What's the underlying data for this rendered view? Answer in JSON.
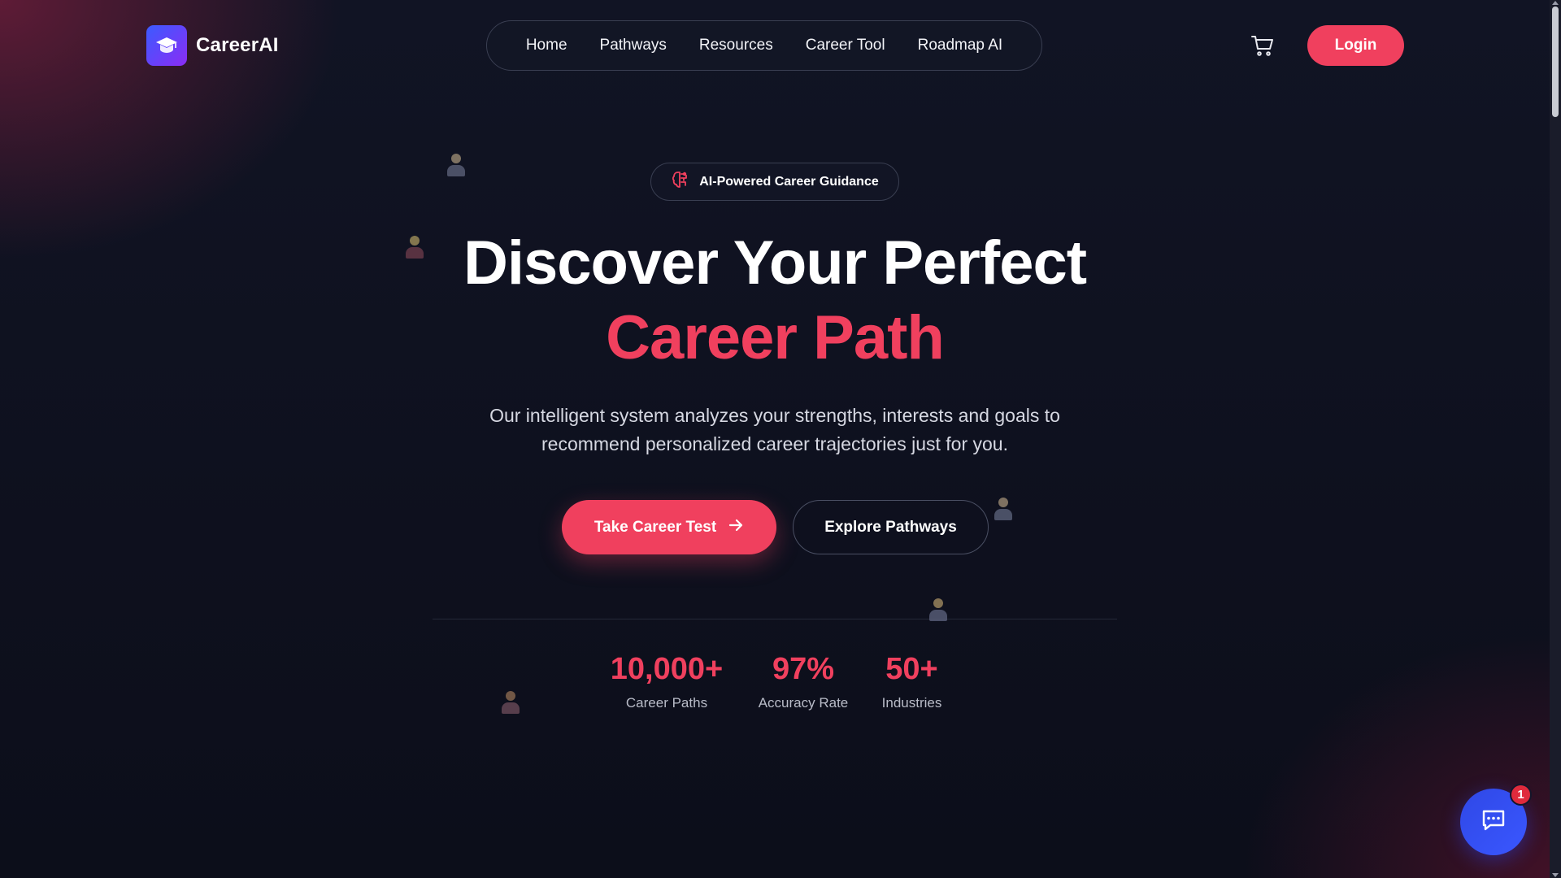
{
  "brand": {
    "name": "CareerAI",
    "logo_icon": "graduation-cap-icon",
    "gradient": [
      "#3b5bff",
      "#8b2cf5"
    ]
  },
  "nav": {
    "items": [
      {
        "label": "Home"
      },
      {
        "label": "Pathways"
      },
      {
        "label": "Resources"
      },
      {
        "label": "Career Tool"
      },
      {
        "label": "Roadmap AI"
      }
    ]
  },
  "header": {
    "cart_icon": "cart-icon",
    "login_label": "Login"
  },
  "hero": {
    "badge_icon": "brain-icon",
    "badge_label": "AI-Powered Career Guidance",
    "title_line1": "Discover Your Perfect",
    "title_line2": "Career Path",
    "subtitle_line1": "Our intelligent system analyzes your strengths, interests and goals to",
    "subtitle_line2": "recommend personalized career trajectories just for you.",
    "primary_cta": "Take Career Test",
    "secondary_cta": "Explore Pathways"
  },
  "stats": [
    {
      "value": "10,000+",
      "label": "Career Paths"
    },
    {
      "value": "97%",
      "label": "Accuracy Rate"
    },
    {
      "value": "50+",
      "label": "Industries"
    }
  ],
  "chat": {
    "icon": "chat-bubble-icon",
    "badge_count": "1"
  },
  "colors": {
    "accent": "#f0405e",
    "background": "#0d0f1c",
    "chat": "#3a57ff"
  }
}
